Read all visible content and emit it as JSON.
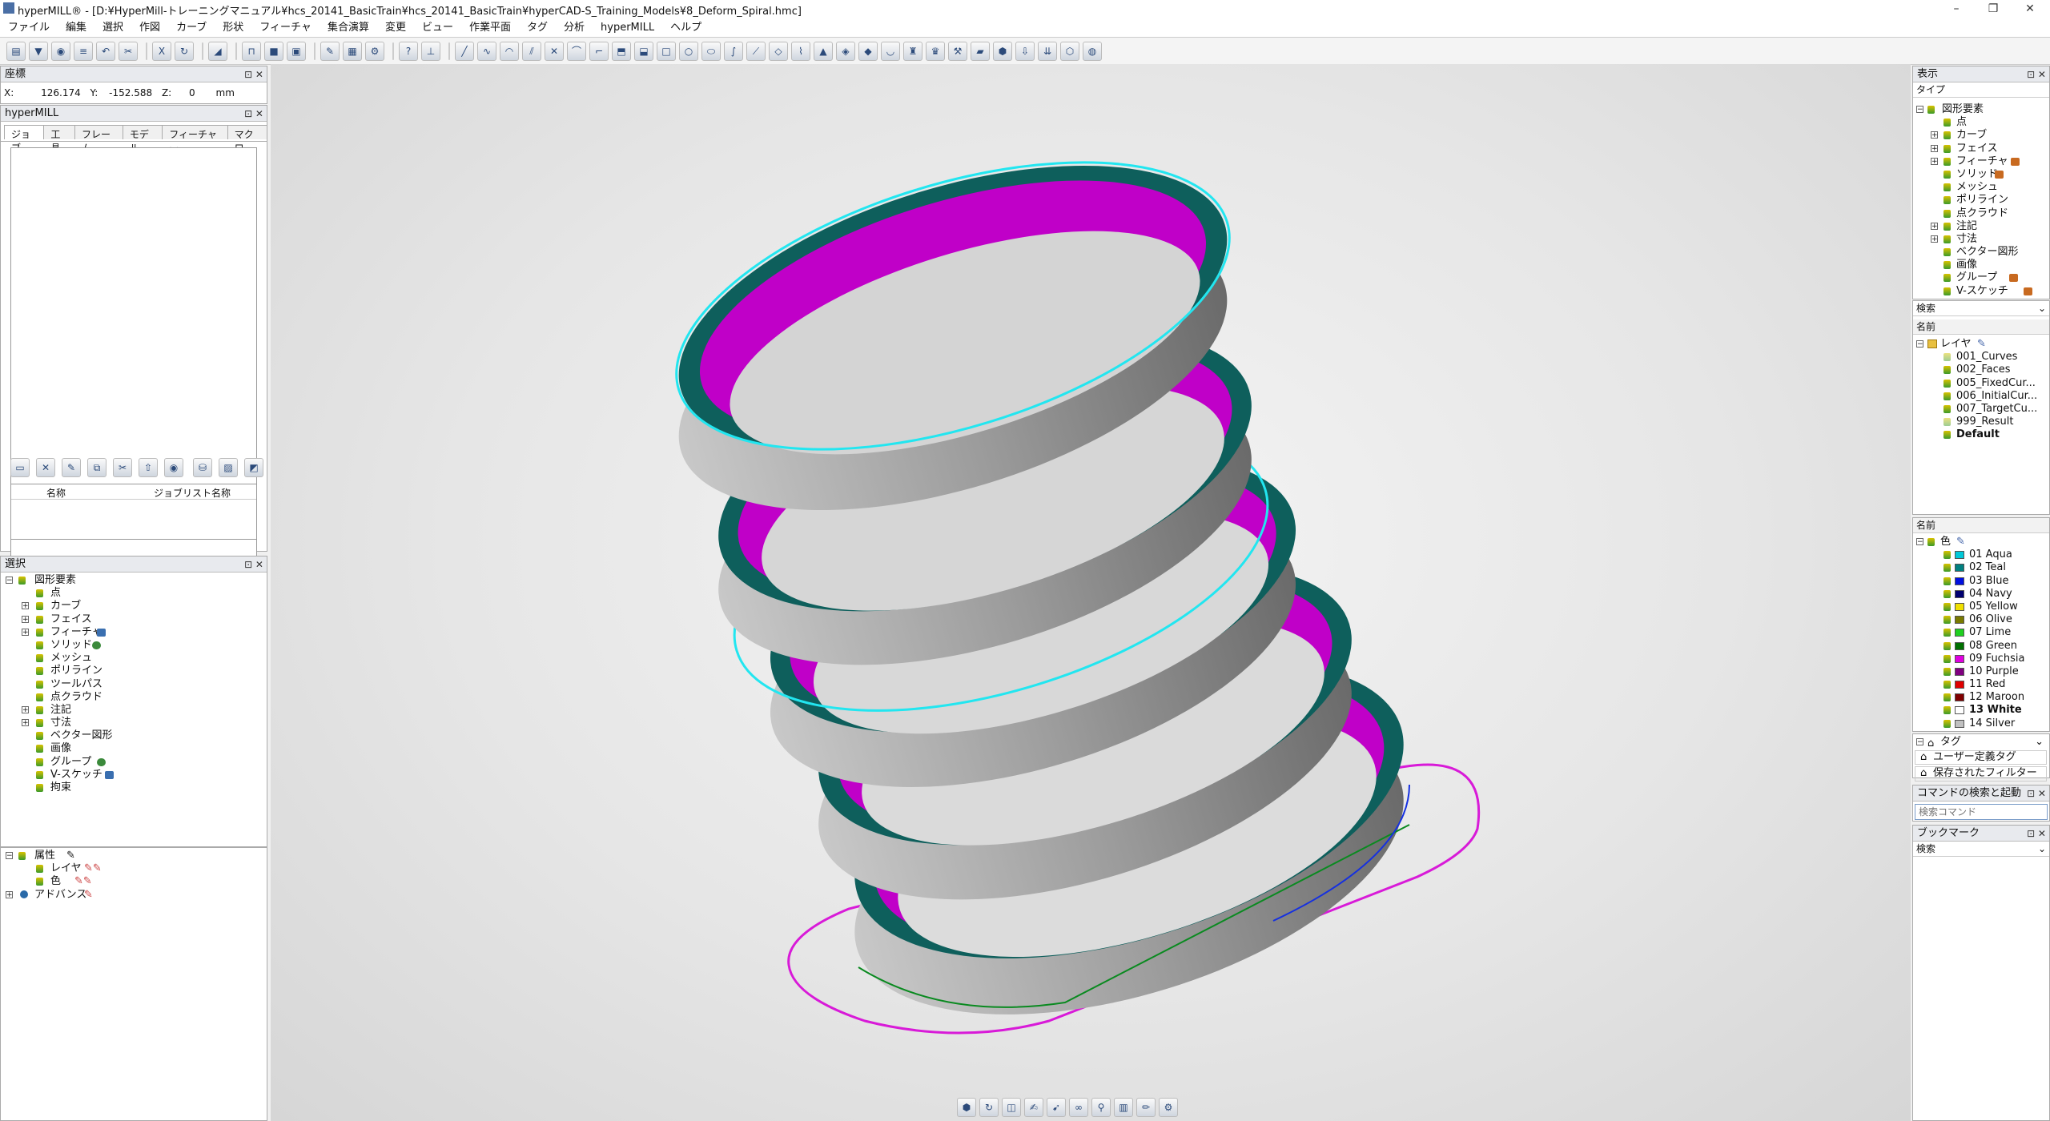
{
  "window": {
    "title": "hyperMILL® - [D:¥HyperMill-トレーニングマニュアル¥hcs_20141_BasicTrain¥hcs_20141_BasicTrain¥hyperCAD-S_Training_Models¥8_Deform_Spiral.hmc]",
    "minimize": "–",
    "restore": "❐",
    "close": "✕"
  },
  "menu": [
    "ファイル",
    "編集",
    "選択",
    "作図",
    "カーブ",
    "形状",
    "フィーチャ",
    "集合演算",
    "変更",
    "ビュー",
    "作業平面",
    "タグ",
    "分析",
    "hyperMILL",
    "ヘルプ"
  ],
  "coords": {
    "title": "座標",
    "x_label": "X:",
    "x": "126.174",
    "y_label": "Y:",
    "y": "-152.588",
    "z_label": "Z:",
    "z": "0",
    "unit": "mm"
  },
  "hypermill": {
    "title": "hyperMILL",
    "tabs": [
      "ジョブ",
      "工具",
      "フレーム",
      "モデル",
      "フィーチャー",
      "マクロ"
    ],
    "columns": [
      "名称",
      "ジョブリスト名称"
    ]
  },
  "selection": {
    "title": "選択",
    "root": "図形要素",
    "items": [
      "点",
      "カーブ",
      "フェイス",
      "フィーチャ",
      "ソリッド",
      "メッシュ",
      "ポリライン",
      "ツールパス",
      "点クラウド",
      "注記",
      "寸法",
      "ベクター図形",
      "画像",
      "グループ",
      "V-スケッチ",
      "拘束"
    ]
  },
  "attributes": {
    "root": "属性",
    "items": [
      "レイヤ",
      "色"
    ],
    "advanced": "アドバンス"
  },
  "display": {
    "title": "表示",
    "type_header": "タイプ",
    "root": "図形要素",
    "items": [
      "点",
      "カーブ",
      "フェイス",
      "フィーチャ",
      "ソリッド",
      "メッシュ",
      "ポリライン",
      "点クラウド",
      "注記",
      "寸法",
      "ベクター図形",
      "画像",
      "グループ",
      "V-スケッチ"
    ]
  },
  "layers": {
    "search_header": "検索",
    "name_header": "名前",
    "root": "レイヤ",
    "items": [
      "001_Curves",
      "002_Faces",
      "005_FixedCur...",
      "006_InitialCur...",
      "007_TargetCu...",
      "999_Result",
      "Default"
    ]
  },
  "colors": {
    "name_header": "名前",
    "root": "色",
    "items": [
      {
        "label": "01 Aqua",
        "color": "#00c8d8"
      },
      {
        "label": "02 Teal",
        "color": "#008080"
      },
      {
        "label": "03 Blue",
        "color": "#0010e0"
      },
      {
        "label": "04 Navy",
        "color": "#000070"
      },
      {
        "label": "05 Yellow",
        "color": "#f0e000"
      },
      {
        "label": "06 Olive",
        "color": "#7a7a00"
      },
      {
        "label": "07 Lime",
        "color": "#20d020"
      },
      {
        "label": "08 Green",
        "color": "#007000"
      },
      {
        "label": "09 Fuchsia",
        "color": "#e000e0"
      },
      {
        "label": "10 Purple",
        "color": "#800080"
      },
      {
        "label": "11 Red",
        "color": "#e00000"
      },
      {
        "label": "12 Maroon",
        "color": "#800000"
      },
      {
        "label": "13 White",
        "color": "#ffffff"
      },
      {
        "label": "14 Silver",
        "color": "#c0c0c0"
      }
    ]
  },
  "tags": {
    "root": "タグ",
    "user_tag": "ユーザー定義タグ",
    "saved_filter": "保存されたフィルター"
  },
  "command_search": {
    "title": "コマンドの検索と起動",
    "placeholder": "検索コマンド"
  },
  "bookmark": {
    "title": "ブックマーク",
    "search": "検索"
  },
  "colors_theme": {
    "gray_face": "#8e8e8e",
    "teal_edge": "#0e5f5c",
    "magenta_inner": "#c000c8",
    "cyan_curve": "#22e6f0",
    "pink_curve": "#d81ad8"
  }
}
